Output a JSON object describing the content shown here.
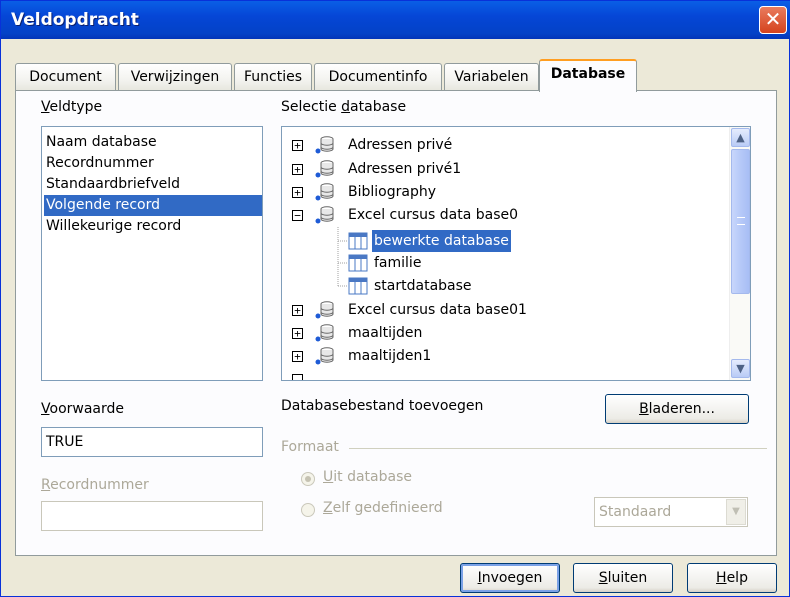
{
  "window": {
    "title": "Veldopdracht",
    "close": "✕"
  },
  "tabs": [
    {
      "label": "Document"
    },
    {
      "label": "Verwijzingen"
    },
    {
      "label": "Functies"
    },
    {
      "label": "Documentinfo"
    },
    {
      "label": "Variabelen"
    },
    {
      "label": "Database"
    }
  ],
  "veldtype": {
    "label_u": "V",
    "label_rest": "eldtype",
    "items": [
      "Naam database",
      "Recordnummer",
      "Standaardbriefveld",
      "Volgende record",
      "Willekeurige record"
    ],
    "selected": "Volgende record"
  },
  "selectie": {
    "label_pre": "Selectie ",
    "label_u": "d",
    "label_rest": "atabase",
    "nodes": [
      {
        "label": "Adressen privé",
        "expander": "+"
      },
      {
        "label": "Adressen privé1",
        "expander": "+"
      },
      {
        "label": "Bibliography",
        "expander": "+"
      },
      {
        "label": "Excel cursus data base0",
        "expander": "−"
      },
      {
        "label": "bewerkte database"
      },
      {
        "label": "familie"
      },
      {
        "label": "startdatabase"
      },
      {
        "label": "Excel cursus data base01",
        "expander": "+"
      },
      {
        "label": "maaltijden",
        "expander": "+"
      },
      {
        "label": "maaltijden1",
        "expander": "+"
      }
    ]
  },
  "voorwaarde": {
    "label_u": "V",
    "label_rest": "oorwaarde",
    "value": "TRUE"
  },
  "recordnummer": {
    "label_u": "R",
    "label_rest": "ecordnummer",
    "value": ""
  },
  "toevoegen": {
    "label": "Databasebestand toevoegen",
    "button_u": "B",
    "button_rest": "laderen..."
  },
  "formaat": {
    "label": "Formaat",
    "opt1_u": "U",
    "opt1_rest": "it database",
    "opt2_u": "Z",
    "opt2_rest": "elf gedefinieerd",
    "combo_value": "Standaard"
  },
  "footer": {
    "insert_u": "I",
    "insert_rest": "nvoegen",
    "close_u": "S",
    "close_rest": "luiten",
    "help_u": "H",
    "help_rest": "elp"
  },
  "colors": {
    "selection": "#316ac5",
    "titlebar": "#0546d6",
    "active_tab_accent": "#ff9e21"
  }
}
